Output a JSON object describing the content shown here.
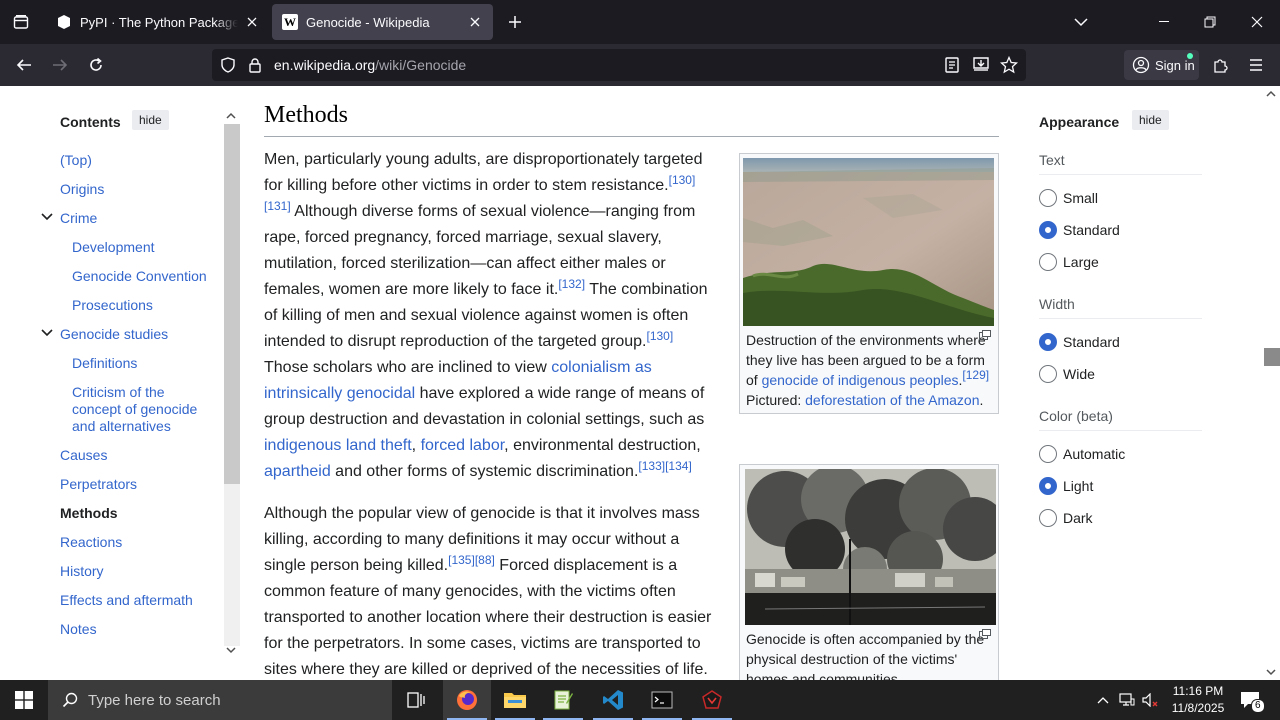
{
  "browser": {
    "tabs": [
      {
        "title": "PyPI · The Python Package Index",
        "active": false
      },
      {
        "title": "Genocide - Wikipedia",
        "active": true
      }
    ],
    "url_domain": "en.wikipedia.org",
    "url_path": "/wiki/Genocide",
    "signin_label": "Sign in"
  },
  "toc": {
    "heading": "Contents",
    "hide_label": "hide",
    "items": [
      {
        "label": "(Top)"
      },
      {
        "label": "Origins"
      },
      {
        "label": "Crime"
      },
      {
        "label": "Development"
      },
      {
        "label": "Genocide Convention"
      },
      {
        "label": "Prosecutions"
      },
      {
        "label": "Genocide studies"
      },
      {
        "label": "Definitions"
      },
      {
        "label": "Criticism of the concept of genocide and alternatives"
      },
      {
        "label": "Causes"
      },
      {
        "label": "Perpetrators"
      },
      {
        "label": "Methods"
      },
      {
        "label": "Reactions"
      },
      {
        "label": "History"
      },
      {
        "label": "Effects and aftermath"
      },
      {
        "label": "Notes"
      }
    ]
  },
  "article": {
    "heading": "Methods",
    "p1": {
      "t1": "Men, particularly young adults, are disproportionately targeted for killing before other victims in order to stem resistance.",
      "r1": "[130]",
      "r2": "[131]",
      "t2": " Although diverse forms of sexual violence—ranging from rape, forced pregnancy, forced marriage, sexual slavery, mutilation, forced sterilization—can affect either males or females, women are more likely to face it.",
      "r3": "[132]",
      "t3": " The combination of killing of men and sexual violence against women is often intended to disrupt reproduction of the targeted group.",
      "r4": "[130]",
      "t4": " Those scholars who are inclined to view ",
      "l1": "colonialism as intrinsically genocidal",
      "t5": " have explored a wide range of means of group destruction and devastation in colonial settings, such as ",
      "l2": "indigenous land theft",
      "t6": ", ",
      "l3": "forced labor",
      "t7": ", environmental destruction, ",
      "l4": "apartheid",
      "t8": " and other forms of systemic discrimination.",
      "r5": "[133]",
      "r6": "[134]"
    },
    "p2": {
      "t1": "Although the popular view of genocide is that it involves mass killing, according to many definitions it may occur without a single person being killed.",
      "r1": "[135]",
      "r2": "[88]",
      "t2": " Forced displacement is a common feature of many genocides, with the victims often transported to another location where their destruction is easier for the perpetrators. In some cases, victims are transported to sites where they are killed or deprived of the necessities of life."
    },
    "fig1": {
      "t1": "Destruction of the environments where they live has been argued to be a form of ",
      "l1": "genocide of indigenous peoples",
      "r1": "[129]",
      "t2": " Pictured: ",
      "l2": "deforestation of the Amazon",
      "t3": "."
    },
    "fig2": {
      "caption": "Genocide is often accompanied by the physical destruction of the victims' homes and communities"
    }
  },
  "appearance": {
    "heading": "Appearance",
    "hide_label": "hide",
    "text_label": "Text",
    "text_options": [
      "Small",
      "Standard",
      "Large"
    ],
    "text_selected": "Standard",
    "width_label": "Width",
    "width_options": [
      "Standard",
      "Wide"
    ],
    "width_selected": "Standard",
    "color_label": "Color (beta)",
    "color_options": [
      "Automatic",
      "Light",
      "Dark"
    ],
    "color_selected": "Light"
  },
  "taskbar": {
    "search_placeholder": "Type here to search",
    "time": "11:16 PM",
    "date": "11/8/2025",
    "notification_count": "6"
  },
  "colors": {
    "link": "#3366cc",
    "tab_bg": "#1c1b22",
    "nav_bg": "#2b2a33",
    "taskbar_bg": "#202020"
  }
}
